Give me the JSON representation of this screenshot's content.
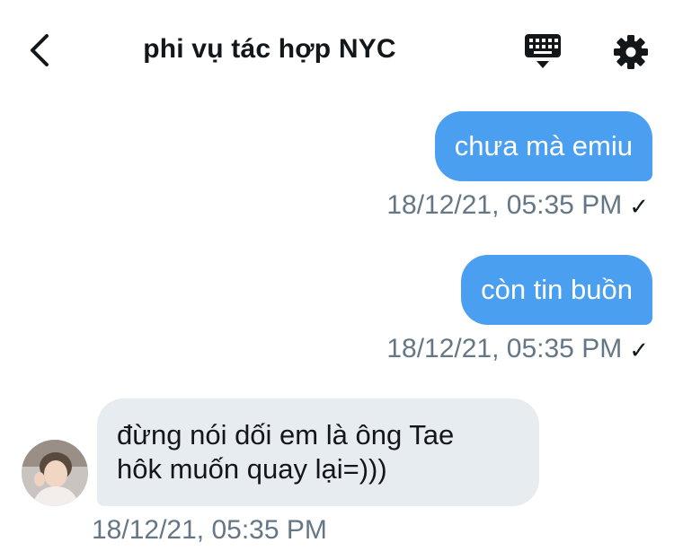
{
  "header": {
    "title": "phi vụ tác hợp NYC",
    "icons": {
      "back": "chevron-left-icon",
      "keyboard": "keyboard-icon",
      "settings": "gear-icon"
    }
  },
  "messages": [
    {
      "direction": "outgoing",
      "text": "chưa mà emiu",
      "timestamp": "18/12/21, 05:35 PM",
      "status": "✓"
    },
    {
      "direction": "outgoing",
      "text": "còn tin buồn",
      "timestamp": "18/12/21, 05:35 PM",
      "status": "✓"
    },
    {
      "direction": "incoming",
      "text_line1": "đừng nói dối em là ông Tae",
      "text_line2": "hôk muốn quay lại=)))",
      "timestamp": "18/12/21, 05:35 PM"
    }
  ],
  "colors": {
    "outgoing_bubble": "#4a9ff1",
    "incoming_bubble": "#e6ecf0",
    "meta_text": "#657786"
  }
}
